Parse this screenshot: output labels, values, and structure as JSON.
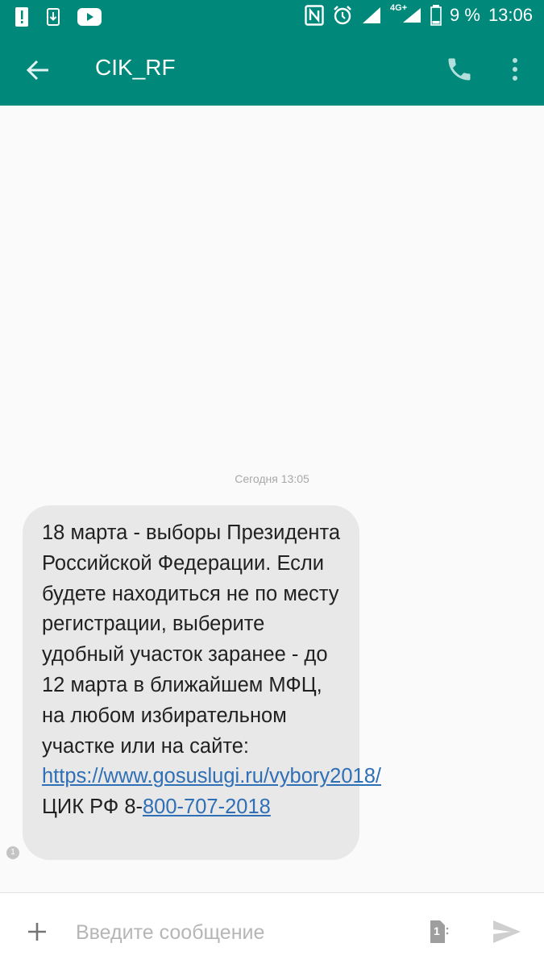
{
  "status_bar": {
    "battery_text": "9 %",
    "time": "13:06",
    "network": "4G+",
    "icons": [
      "alert-icon",
      "sim-download-icon",
      "youtube-icon",
      "nfc-icon",
      "alarm-icon",
      "signal-icon",
      "battery-icon"
    ]
  },
  "app_bar": {
    "title": "CIK_RF",
    "icons": [
      "back-arrow-icon",
      "phone-icon",
      "more-vert-icon"
    ]
  },
  "conversation": {
    "timestamp": "Сегодня 13:05",
    "message": {
      "sim_badge": "1",
      "text_before_link": "18 марта - выборы Президента Российской Федерации. Если будете находиться не по месту регистрации, выберите удобный участок заранее - до 12 марта в ближайшем МФЦ, на любом избирательном участке или на сайте: ",
      "url": "https://www.gosuslugi.ru/vybory2018/",
      "text_between": "\nЦИК РФ 8-",
      "phone": "800-707-2018"
    }
  },
  "compose": {
    "placeholder": "Введите сообщение",
    "sim_label": "1"
  },
  "colors": {
    "primary": "#00897b",
    "bubble": "#e8e8e8",
    "link": "#2f6fb5"
  }
}
